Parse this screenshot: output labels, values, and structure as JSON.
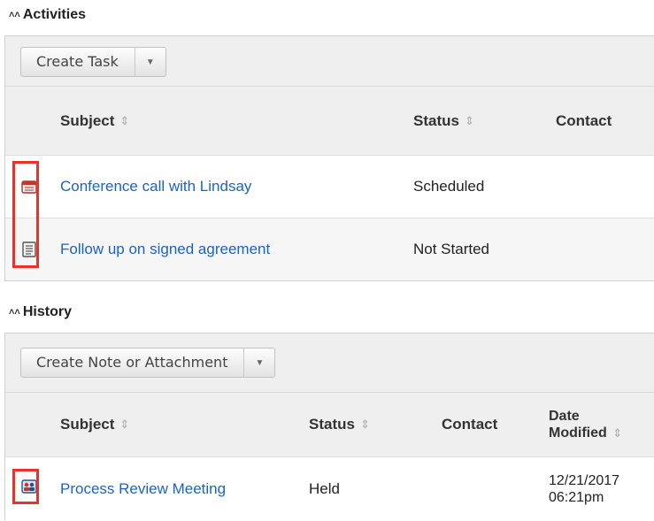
{
  "activities": {
    "title": "Activities",
    "create_button": "Create Task",
    "columns": {
      "subject": "Subject",
      "status": "Status",
      "contact": "Contact"
    },
    "rows": [
      {
        "subject": "Conference call with Lindsay",
        "status": "Scheduled",
        "icon": "calendar-icon"
      },
      {
        "subject": "Follow up on signed agreement",
        "status": "Not Started",
        "icon": "task-list-icon"
      }
    ]
  },
  "history": {
    "title": "History",
    "create_button": "Create Note or Attachment",
    "columns": {
      "subject": "Subject",
      "status": "Status",
      "contact": "Contact",
      "date_modified_line1": "Date",
      "date_modified_line2": "Modified"
    },
    "rows": [
      {
        "subject": "Process Review Meeting",
        "status": "Held",
        "date_line1": "12/21/2017",
        "date_line2": "06:21pm",
        "icon": "meeting-icon"
      }
    ]
  },
  "colors": {
    "link": "#1a63c9",
    "highlight": "#e8322a",
    "toolbar_bg": "#efefef"
  }
}
